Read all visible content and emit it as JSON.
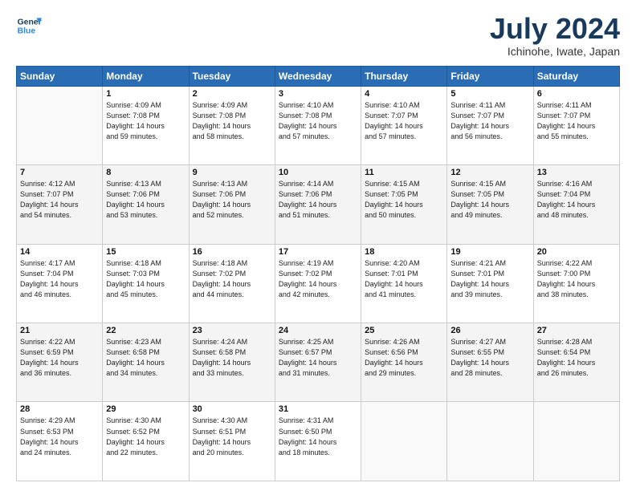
{
  "logo": {
    "line1": "General",
    "line2": "Blue"
  },
  "title": "July 2024",
  "subtitle": "Ichinohe, Iwate, Japan",
  "headers": [
    "Sunday",
    "Monday",
    "Tuesday",
    "Wednesday",
    "Thursday",
    "Friday",
    "Saturday"
  ],
  "weeks": [
    [
      {
        "day": "",
        "info": ""
      },
      {
        "day": "1",
        "info": "Sunrise: 4:09 AM\nSunset: 7:08 PM\nDaylight: 14 hours\nand 59 minutes."
      },
      {
        "day": "2",
        "info": "Sunrise: 4:09 AM\nSunset: 7:08 PM\nDaylight: 14 hours\nand 58 minutes."
      },
      {
        "day": "3",
        "info": "Sunrise: 4:10 AM\nSunset: 7:08 PM\nDaylight: 14 hours\nand 57 minutes."
      },
      {
        "day": "4",
        "info": "Sunrise: 4:10 AM\nSunset: 7:07 PM\nDaylight: 14 hours\nand 57 minutes."
      },
      {
        "day": "5",
        "info": "Sunrise: 4:11 AM\nSunset: 7:07 PM\nDaylight: 14 hours\nand 56 minutes."
      },
      {
        "day": "6",
        "info": "Sunrise: 4:11 AM\nSunset: 7:07 PM\nDaylight: 14 hours\nand 55 minutes."
      }
    ],
    [
      {
        "day": "7",
        "info": "Sunrise: 4:12 AM\nSunset: 7:07 PM\nDaylight: 14 hours\nand 54 minutes."
      },
      {
        "day": "8",
        "info": "Sunrise: 4:13 AM\nSunset: 7:06 PM\nDaylight: 14 hours\nand 53 minutes."
      },
      {
        "day": "9",
        "info": "Sunrise: 4:13 AM\nSunset: 7:06 PM\nDaylight: 14 hours\nand 52 minutes."
      },
      {
        "day": "10",
        "info": "Sunrise: 4:14 AM\nSunset: 7:06 PM\nDaylight: 14 hours\nand 51 minutes."
      },
      {
        "day": "11",
        "info": "Sunrise: 4:15 AM\nSunset: 7:05 PM\nDaylight: 14 hours\nand 50 minutes."
      },
      {
        "day": "12",
        "info": "Sunrise: 4:15 AM\nSunset: 7:05 PM\nDaylight: 14 hours\nand 49 minutes."
      },
      {
        "day": "13",
        "info": "Sunrise: 4:16 AM\nSunset: 7:04 PM\nDaylight: 14 hours\nand 48 minutes."
      }
    ],
    [
      {
        "day": "14",
        "info": "Sunrise: 4:17 AM\nSunset: 7:04 PM\nDaylight: 14 hours\nand 46 minutes."
      },
      {
        "day": "15",
        "info": "Sunrise: 4:18 AM\nSunset: 7:03 PM\nDaylight: 14 hours\nand 45 minutes."
      },
      {
        "day": "16",
        "info": "Sunrise: 4:18 AM\nSunset: 7:02 PM\nDaylight: 14 hours\nand 44 minutes."
      },
      {
        "day": "17",
        "info": "Sunrise: 4:19 AM\nSunset: 7:02 PM\nDaylight: 14 hours\nand 42 minutes."
      },
      {
        "day": "18",
        "info": "Sunrise: 4:20 AM\nSunset: 7:01 PM\nDaylight: 14 hours\nand 41 minutes."
      },
      {
        "day": "19",
        "info": "Sunrise: 4:21 AM\nSunset: 7:01 PM\nDaylight: 14 hours\nand 39 minutes."
      },
      {
        "day": "20",
        "info": "Sunrise: 4:22 AM\nSunset: 7:00 PM\nDaylight: 14 hours\nand 38 minutes."
      }
    ],
    [
      {
        "day": "21",
        "info": "Sunrise: 4:22 AM\nSunset: 6:59 PM\nDaylight: 14 hours\nand 36 minutes."
      },
      {
        "day": "22",
        "info": "Sunrise: 4:23 AM\nSunset: 6:58 PM\nDaylight: 14 hours\nand 34 minutes."
      },
      {
        "day": "23",
        "info": "Sunrise: 4:24 AM\nSunset: 6:58 PM\nDaylight: 14 hours\nand 33 minutes."
      },
      {
        "day": "24",
        "info": "Sunrise: 4:25 AM\nSunset: 6:57 PM\nDaylight: 14 hours\nand 31 minutes."
      },
      {
        "day": "25",
        "info": "Sunrise: 4:26 AM\nSunset: 6:56 PM\nDaylight: 14 hours\nand 29 minutes."
      },
      {
        "day": "26",
        "info": "Sunrise: 4:27 AM\nSunset: 6:55 PM\nDaylight: 14 hours\nand 28 minutes."
      },
      {
        "day": "27",
        "info": "Sunrise: 4:28 AM\nSunset: 6:54 PM\nDaylight: 14 hours\nand 26 minutes."
      }
    ],
    [
      {
        "day": "28",
        "info": "Sunrise: 4:29 AM\nSunset: 6:53 PM\nDaylight: 14 hours\nand 24 minutes."
      },
      {
        "day": "29",
        "info": "Sunrise: 4:30 AM\nSunset: 6:52 PM\nDaylight: 14 hours\nand 22 minutes."
      },
      {
        "day": "30",
        "info": "Sunrise: 4:30 AM\nSunset: 6:51 PM\nDaylight: 14 hours\nand 20 minutes."
      },
      {
        "day": "31",
        "info": "Sunrise: 4:31 AM\nSunset: 6:50 PM\nDaylight: 14 hours\nand 18 minutes."
      },
      {
        "day": "",
        "info": ""
      },
      {
        "day": "",
        "info": ""
      },
      {
        "day": "",
        "info": ""
      }
    ]
  ]
}
